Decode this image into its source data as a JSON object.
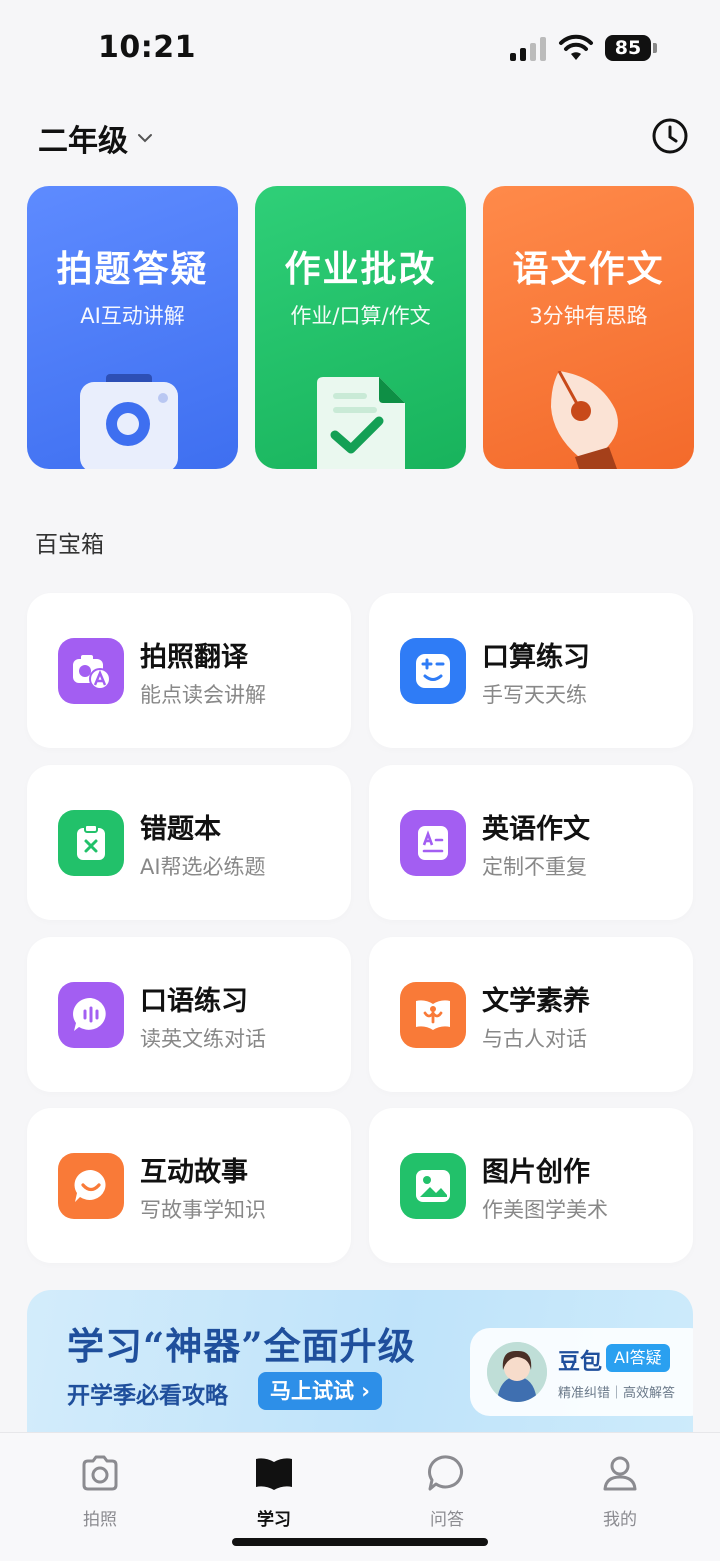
{
  "status": {
    "time": "10:21",
    "battery": "85"
  },
  "header": {
    "grade": "二年级"
  },
  "features": [
    {
      "title": "拍题答疑",
      "subtitle": "AI互动讲解",
      "color": "#4d7cf6",
      "icon": "camera-icon"
    },
    {
      "title": "作业批改",
      "subtitle": "作业/口算/作文",
      "color": "#22c16a",
      "icon": "document-check-icon"
    },
    {
      "title": "语文作文",
      "subtitle": "3分钟有思路",
      "color": "#f97a38",
      "icon": "pen-nib-icon"
    }
  ],
  "toolbox": {
    "title": "百宝箱",
    "items": [
      {
        "name": "拍照翻译",
        "desc": "能点读会讲解",
        "color": "#a35ef2",
        "icon": "camera-translate-icon"
      },
      {
        "name": "口算练习",
        "desc": "手写天天练",
        "color": "#2f7cf6",
        "icon": "math-face-icon"
      },
      {
        "name": "错题本",
        "desc": "AI帮选必练题",
        "color": "#22c16a",
        "icon": "clipboard-x-icon"
      },
      {
        "name": "英语作文",
        "desc": "定制不重复",
        "color": "#a35ef2",
        "icon": "english-doc-icon"
      },
      {
        "name": "口语练习",
        "desc": "读英文练对话",
        "color": "#a35ef2",
        "icon": "speech-bubble-icon"
      },
      {
        "name": "文学素养",
        "desc": "与古人对话",
        "color": "#f97a38",
        "icon": "open-book-icon"
      },
      {
        "name": "互动故事",
        "desc": "写故事学知识",
        "color": "#f97a38",
        "icon": "chat-smile-icon"
      },
      {
        "name": "图片创作",
        "desc": "作美图学美术",
        "color": "#22c16a",
        "icon": "image-icon"
      }
    ]
  },
  "banner": {
    "title": "学习“神器”全面升级",
    "subtitle": "开学季必看攻略",
    "button": "马上试试",
    "card_name": "豆包",
    "card_tag": "AI答疑",
    "card_desc": "精准纠错｜高效解答"
  },
  "tabs": [
    {
      "label": "拍照",
      "icon": "camera-tab-icon",
      "active": false
    },
    {
      "label": "学习",
      "icon": "book-tab-icon",
      "active": true
    },
    {
      "label": "问答",
      "icon": "chat-tab-icon",
      "active": false
    },
    {
      "label": "我的",
      "icon": "profile-tab-icon",
      "active": false
    }
  ]
}
